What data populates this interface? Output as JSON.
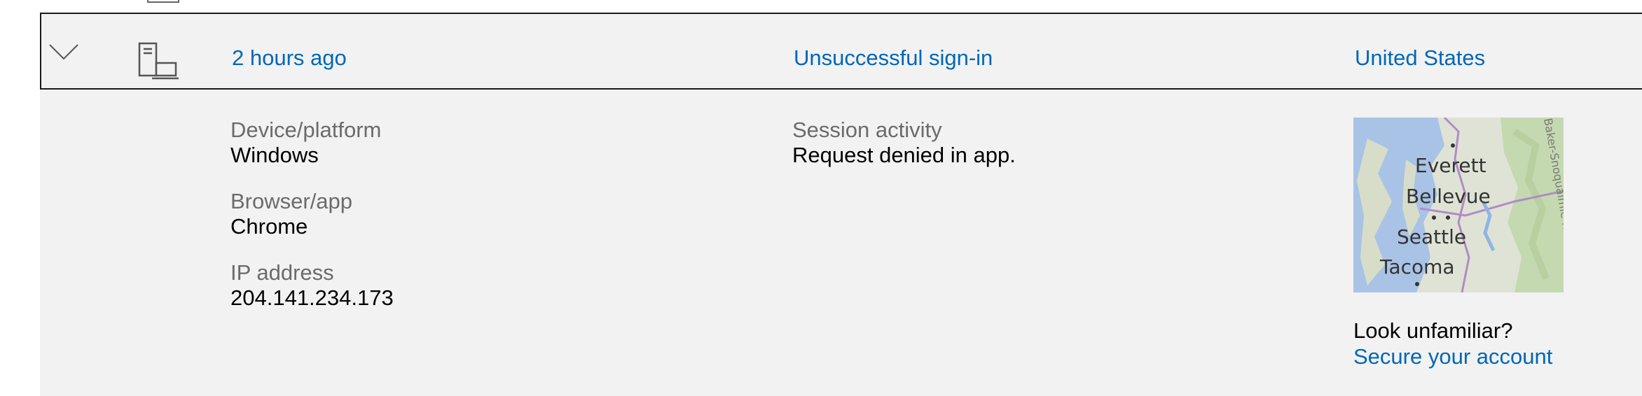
{
  "activity": {
    "time": "2 hours ago",
    "event": "Unsuccessful sign-in",
    "location": "United States",
    "device_icon": "computer-icon",
    "details": {
      "device_label": "Device/platform",
      "device_value": "Windows",
      "browser_label": "Browser/app",
      "browser_value": "Chrome",
      "ip_label": "IP address",
      "ip_value": "204.141.234.173",
      "session_label": "Session activity",
      "session_value": "Request denied in app."
    },
    "map": {
      "cities": [
        "Everett",
        "Bellevue",
        "Seattle",
        "Tacoma"
      ],
      "edge_label": "Baker-Snoqualmie Nation"
    },
    "look_unfamiliar": "Look unfamiliar?",
    "secure_link": "Secure your account"
  },
  "colors": {
    "link": "#0067b8",
    "row_background": "#f2f2f2",
    "label_gray": "#6b6b6b"
  }
}
